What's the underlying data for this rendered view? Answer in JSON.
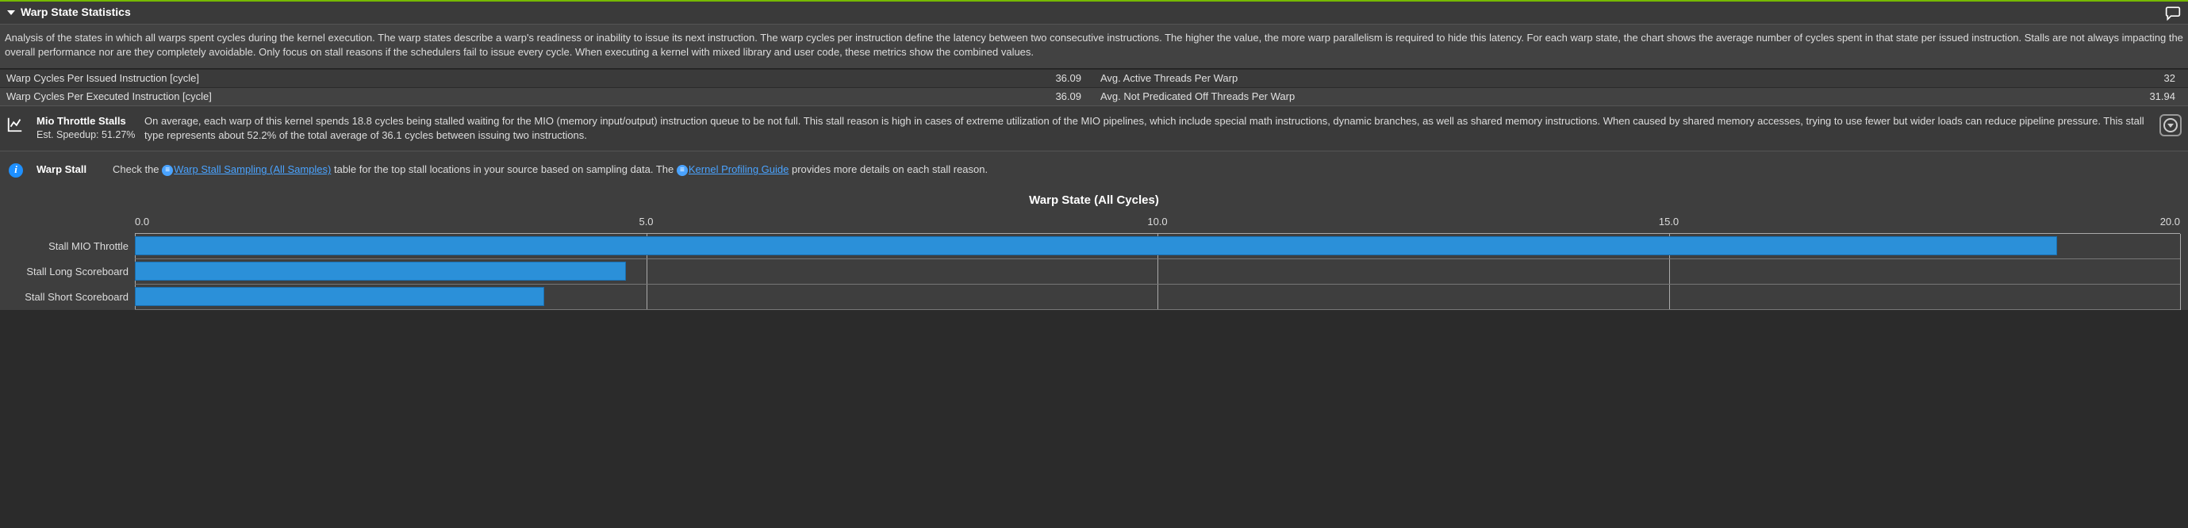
{
  "header": {
    "title": "Warp State Statistics"
  },
  "description": "Analysis of the states in which all warps spent cycles during the kernel execution. The warp states describe a warp's readiness or inability to issue its next instruction. The warp cycles per instruction define the latency between two consecutive instructions. The higher the value, the more warp parallelism is required to hide this latency. For each warp state, the chart shows the average number of cycles spent in that state per issued instruction. Stalls are not always impacting the overall performance nor are they completely avoidable. Only focus on stall reasons if the schedulers fail to issue every cycle. When executing a kernel with mixed library and user code, these metrics show the combined values.",
  "metrics": [
    {
      "label": "Warp Cycles Per Issued Instruction [cycle]",
      "value": "36.09",
      "label2": "Avg. Active Threads Per Warp",
      "value2": "32"
    },
    {
      "label": "Warp Cycles Per Executed Instruction [cycle]",
      "value": "36.09",
      "label2": "Avg. Not Predicated Off Threads Per Warp",
      "value2": "31.94"
    }
  ],
  "advice": {
    "title": "Mio Throttle Stalls",
    "speedup": "Est. Speedup: 51.27%",
    "body": "On average, each warp of this kernel spends 18.8 cycles being stalled waiting for the MIO (memory input/output) instruction queue to be not full. This stall reason is high in cases of extreme utilization of the MIO pipelines, which include special math instructions, dynamic branches, as well as shared memory instructions. When caused by shared memory accesses, trying to use fewer but wider loads can reduce pipeline pressure. This stall type represents about 52.2% of the total average of 36.1 cycles between issuing two instructions."
  },
  "info": {
    "label": "Warp Stall",
    "pre": "Check the ",
    "link1": "Warp Stall Sampling (All Samples)",
    "mid": " table for the top stall locations in your source based on sampling data. The ",
    "link2": "Kernel Profiling Guide",
    "post": " provides more details on each stall reason."
  },
  "chart_data": {
    "type": "bar",
    "title": "Warp State (All Cycles)",
    "xlabel": "",
    "ylabel": "",
    "xlim": [
      0,
      20
    ],
    "xticks": [
      0.0,
      5.0,
      10.0,
      15.0,
      20.0
    ],
    "categories": [
      "Stall MIO Throttle",
      "Stall Long Scoreboard",
      "Stall Short Scoreboard"
    ],
    "values": [
      18.8,
      4.8,
      4.0
    ]
  }
}
